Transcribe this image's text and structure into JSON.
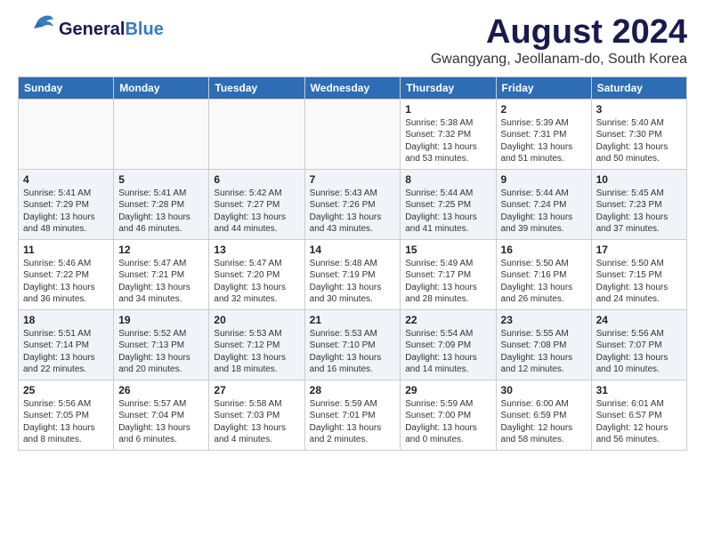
{
  "header": {
    "logo_general": "General",
    "logo_blue": "Blue",
    "month_title": "August 2024",
    "subtitle": "Gwangyang, Jeollanam-do, South Korea"
  },
  "weekdays": [
    "Sunday",
    "Monday",
    "Tuesday",
    "Wednesday",
    "Thursday",
    "Friday",
    "Saturday"
  ],
  "weeks": [
    [
      {
        "day": "",
        "info": ""
      },
      {
        "day": "",
        "info": ""
      },
      {
        "day": "",
        "info": ""
      },
      {
        "day": "",
        "info": ""
      },
      {
        "day": "1",
        "info": "Sunrise: 5:38 AM\nSunset: 7:32 PM\nDaylight: 13 hours\nand 53 minutes."
      },
      {
        "day": "2",
        "info": "Sunrise: 5:39 AM\nSunset: 7:31 PM\nDaylight: 13 hours\nand 51 minutes."
      },
      {
        "day": "3",
        "info": "Sunrise: 5:40 AM\nSunset: 7:30 PM\nDaylight: 13 hours\nand 50 minutes."
      }
    ],
    [
      {
        "day": "4",
        "info": "Sunrise: 5:41 AM\nSunset: 7:29 PM\nDaylight: 13 hours\nand 48 minutes."
      },
      {
        "day": "5",
        "info": "Sunrise: 5:41 AM\nSunset: 7:28 PM\nDaylight: 13 hours\nand 46 minutes."
      },
      {
        "day": "6",
        "info": "Sunrise: 5:42 AM\nSunset: 7:27 PM\nDaylight: 13 hours\nand 44 minutes."
      },
      {
        "day": "7",
        "info": "Sunrise: 5:43 AM\nSunset: 7:26 PM\nDaylight: 13 hours\nand 43 minutes."
      },
      {
        "day": "8",
        "info": "Sunrise: 5:44 AM\nSunset: 7:25 PM\nDaylight: 13 hours\nand 41 minutes."
      },
      {
        "day": "9",
        "info": "Sunrise: 5:44 AM\nSunset: 7:24 PM\nDaylight: 13 hours\nand 39 minutes."
      },
      {
        "day": "10",
        "info": "Sunrise: 5:45 AM\nSunset: 7:23 PM\nDaylight: 13 hours\nand 37 minutes."
      }
    ],
    [
      {
        "day": "11",
        "info": "Sunrise: 5:46 AM\nSunset: 7:22 PM\nDaylight: 13 hours\nand 36 minutes."
      },
      {
        "day": "12",
        "info": "Sunrise: 5:47 AM\nSunset: 7:21 PM\nDaylight: 13 hours\nand 34 minutes."
      },
      {
        "day": "13",
        "info": "Sunrise: 5:47 AM\nSunset: 7:20 PM\nDaylight: 13 hours\nand 32 minutes."
      },
      {
        "day": "14",
        "info": "Sunrise: 5:48 AM\nSunset: 7:19 PM\nDaylight: 13 hours\nand 30 minutes."
      },
      {
        "day": "15",
        "info": "Sunrise: 5:49 AM\nSunset: 7:17 PM\nDaylight: 13 hours\nand 28 minutes."
      },
      {
        "day": "16",
        "info": "Sunrise: 5:50 AM\nSunset: 7:16 PM\nDaylight: 13 hours\nand 26 minutes."
      },
      {
        "day": "17",
        "info": "Sunrise: 5:50 AM\nSunset: 7:15 PM\nDaylight: 13 hours\nand 24 minutes."
      }
    ],
    [
      {
        "day": "18",
        "info": "Sunrise: 5:51 AM\nSunset: 7:14 PM\nDaylight: 13 hours\nand 22 minutes."
      },
      {
        "day": "19",
        "info": "Sunrise: 5:52 AM\nSunset: 7:13 PM\nDaylight: 13 hours\nand 20 minutes."
      },
      {
        "day": "20",
        "info": "Sunrise: 5:53 AM\nSunset: 7:12 PM\nDaylight: 13 hours\nand 18 minutes."
      },
      {
        "day": "21",
        "info": "Sunrise: 5:53 AM\nSunset: 7:10 PM\nDaylight: 13 hours\nand 16 minutes."
      },
      {
        "day": "22",
        "info": "Sunrise: 5:54 AM\nSunset: 7:09 PM\nDaylight: 13 hours\nand 14 minutes."
      },
      {
        "day": "23",
        "info": "Sunrise: 5:55 AM\nSunset: 7:08 PM\nDaylight: 13 hours\nand 12 minutes."
      },
      {
        "day": "24",
        "info": "Sunrise: 5:56 AM\nSunset: 7:07 PM\nDaylight: 13 hours\nand 10 minutes."
      }
    ],
    [
      {
        "day": "25",
        "info": "Sunrise: 5:56 AM\nSunset: 7:05 PM\nDaylight: 13 hours\nand 8 minutes."
      },
      {
        "day": "26",
        "info": "Sunrise: 5:57 AM\nSunset: 7:04 PM\nDaylight: 13 hours\nand 6 minutes."
      },
      {
        "day": "27",
        "info": "Sunrise: 5:58 AM\nSunset: 7:03 PM\nDaylight: 13 hours\nand 4 minutes."
      },
      {
        "day": "28",
        "info": "Sunrise: 5:59 AM\nSunset: 7:01 PM\nDaylight: 13 hours\nand 2 minutes."
      },
      {
        "day": "29",
        "info": "Sunrise: 5:59 AM\nSunset: 7:00 PM\nDaylight: 13 hours\nand 0 minutes."
      },
      {
        "day": "30",
        "info": "Sunrise: 6:00 AM\nSunset: 6:59 PM\nDaylight: 12 hours\nand 58 minutes."
      },
      {
        "day": "31",
        "info": "Sunrise: 6:01 AM\nSunset: 6:57 PM\nDaylight: 12 hours\nand 56 minutes."
      }
    ]
  ]
}
